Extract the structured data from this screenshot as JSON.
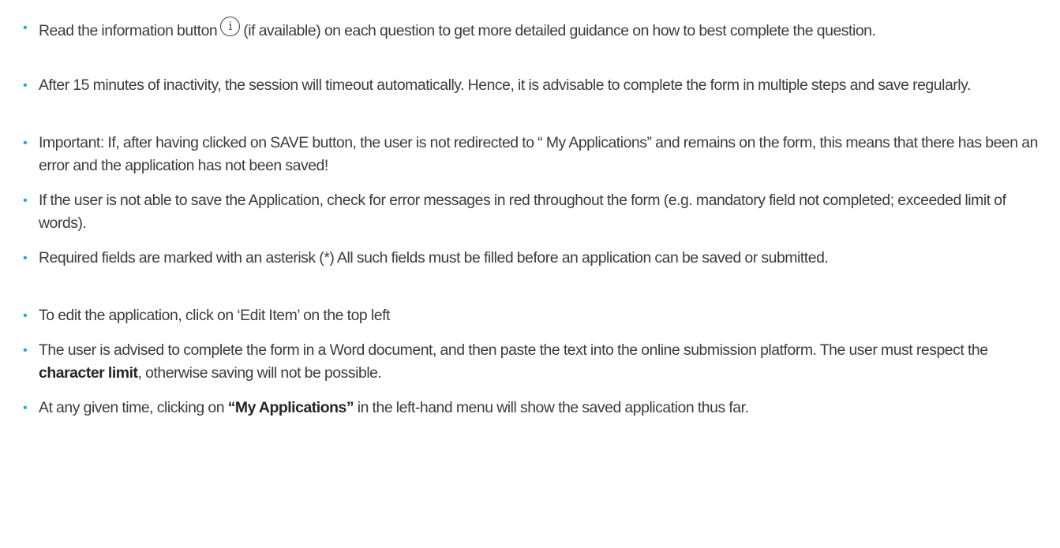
{
  "bullet_glyph": "•",
  "items": [
    {
      "before": "Read the information button",
      "icon": "info-icon",
      "icon_glyph": "i",
      "after": "(if available) on each question to get more detailed guidance on how to best complete the question."
    },
    {
      "text": "After 15 minutes of inactivity, the session will timeout automatically. Hence, it is advisable to complete the form in multiple steps and save regularly."
    },
    {
      "text": "Important: If, after having clicked on SAVE button, the user is not redirected to “ My Applications” and remains on the form, this means that there has been an error and the application has not been saved!"
    },
    {
      "text": "If the user is not able to save the Application, check for error messages in red throughout the  form (e.g. mandatory field not completed; exceeded limit of words)."
    },
    {
      "text": "Required fields are marked with an asterisk (*) All such fields must be filled before an application can be saved or submitted."
    },
    {
      "text": "To edit the application, click on ‘Edit Item’ on the top left"
    },
    {
      "before": "The user is advised to complete the form in a Word document, and then paste the text into the online submission platform. The user must respect the ",
      "bold": "character limit",
      "after": ", otherwise saving will not be possible."
    },
    {
      "before": "At any given time, clicking on ",
      "bold": "“My Applications”",
      "after": " in the left-hand menu will show the saved application thus far."
    }
  ]
}
